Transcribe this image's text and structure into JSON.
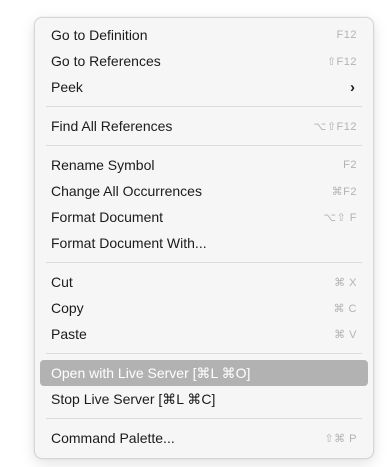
{
  "menu": {
    "items": [
      {
        "label": "Go to Definition",
        "shortcut": "F12"
      },
      {
        "label": "Go to References",
        "shortcut": "⇧F12"
      },
      {
        "label": "Peek",
        "submenu_icon": "chevron-right-icon"
      },
      {
        "label": "Find All References",
        "shortcut": "⌥⇧F12"
      },
      {
        "label": "Rename Symbol",
        "shortcut": "F2"
      },
      {
        "label": "Change All Occurrences",
        "shortcut": "⌘F2"
      },
      {
        "label": "Format Document",
        "shortcut": "⌥⇧ F"
      },
      {
        "label": "Format Document With..."
      },
      {
        "label": "Cut",
        "shortcut": "⌘ X"
      },
      {
        "label": "Copy",
        "shortcut": "⌘ C"
      },
      {
        "label": "Paste",
        "shortcut": "⌘ V"
      },
      {
        "label": "Open with Live Server [⌘L ⌘O]",
        "highlighted": true
      },
      {
        "label": "Stop Live Server [⌘L ⌘C]"
      },
      {
        "label": "Command Palette...",
        "shortcut": "⇧⌘ P"
      }
    ],
    "highlight_color": "#b2b2b2"
  }
}
